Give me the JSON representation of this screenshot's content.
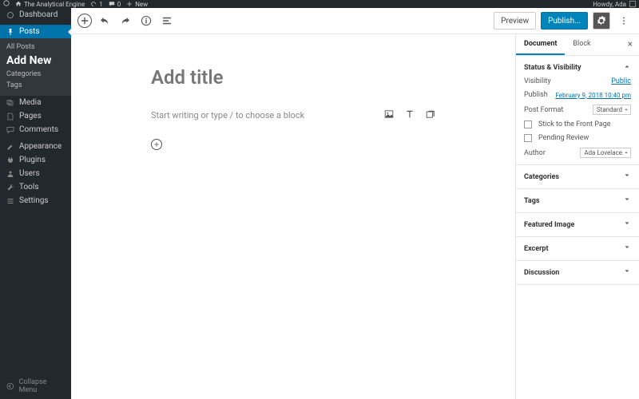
{
  "adminbar": {
    "site": "The Analytical Engine",
    "updates": "1",
    "comments": "0",
    "new": "New",
    "howdy": "Howdy, Ada"
  },
  "sidebar": {
    "dashboard": "Dashboard",
    "posts": "Posts",
    "submenu": {
      "all": "All Posts",
      "add": "Add New",
      "categories": "Categories",
      "tags": "Tags"
    },
    "media": "Media",
    "pages": "Pages",
    "comments": "Comments",
    "appearance": "Appearance",
    "plugins": "Plugins",
    "users": "Users",
    "tools": "Tools",
    "settings": "Settings",
    "collapse": "Collapse Menu"
  },
  "topbar": {
    "preview": "Preview",
    "publish": "Publish..."
  },
  "editor": {
    "title_placeholder": "Add title",
    "body_placeholder": "Start writing or type / to choose a block"
  },
  "inspector": {
    "tab_document": "Document",
    "tab_block": "Block",
    "status": {
      "heading": "Status & Visibility",
      "visibility": {
        "label": "Visibility",
        "value": "Public"
      },
      "publish": {
        "label": "Publish",
        "value": "February 9, 2018 10:40 pm"
      },
      "post_format": {
        "label": "Post Format",
        "value": "Standard"
      },
      "stick": "Stick to the Front Page",
      "pending": "Pending Review",
      "author": {
        "label": "Author",
        "value": "Ada Lovelace"
      }
    },
    "panels": {
      "categories": "Categories",
      "tags": "Tags",
      "featured": "Featured Image",
      "excerpt": "Excerpt",
      "discussion": "Discussion"
    }
  }
}
